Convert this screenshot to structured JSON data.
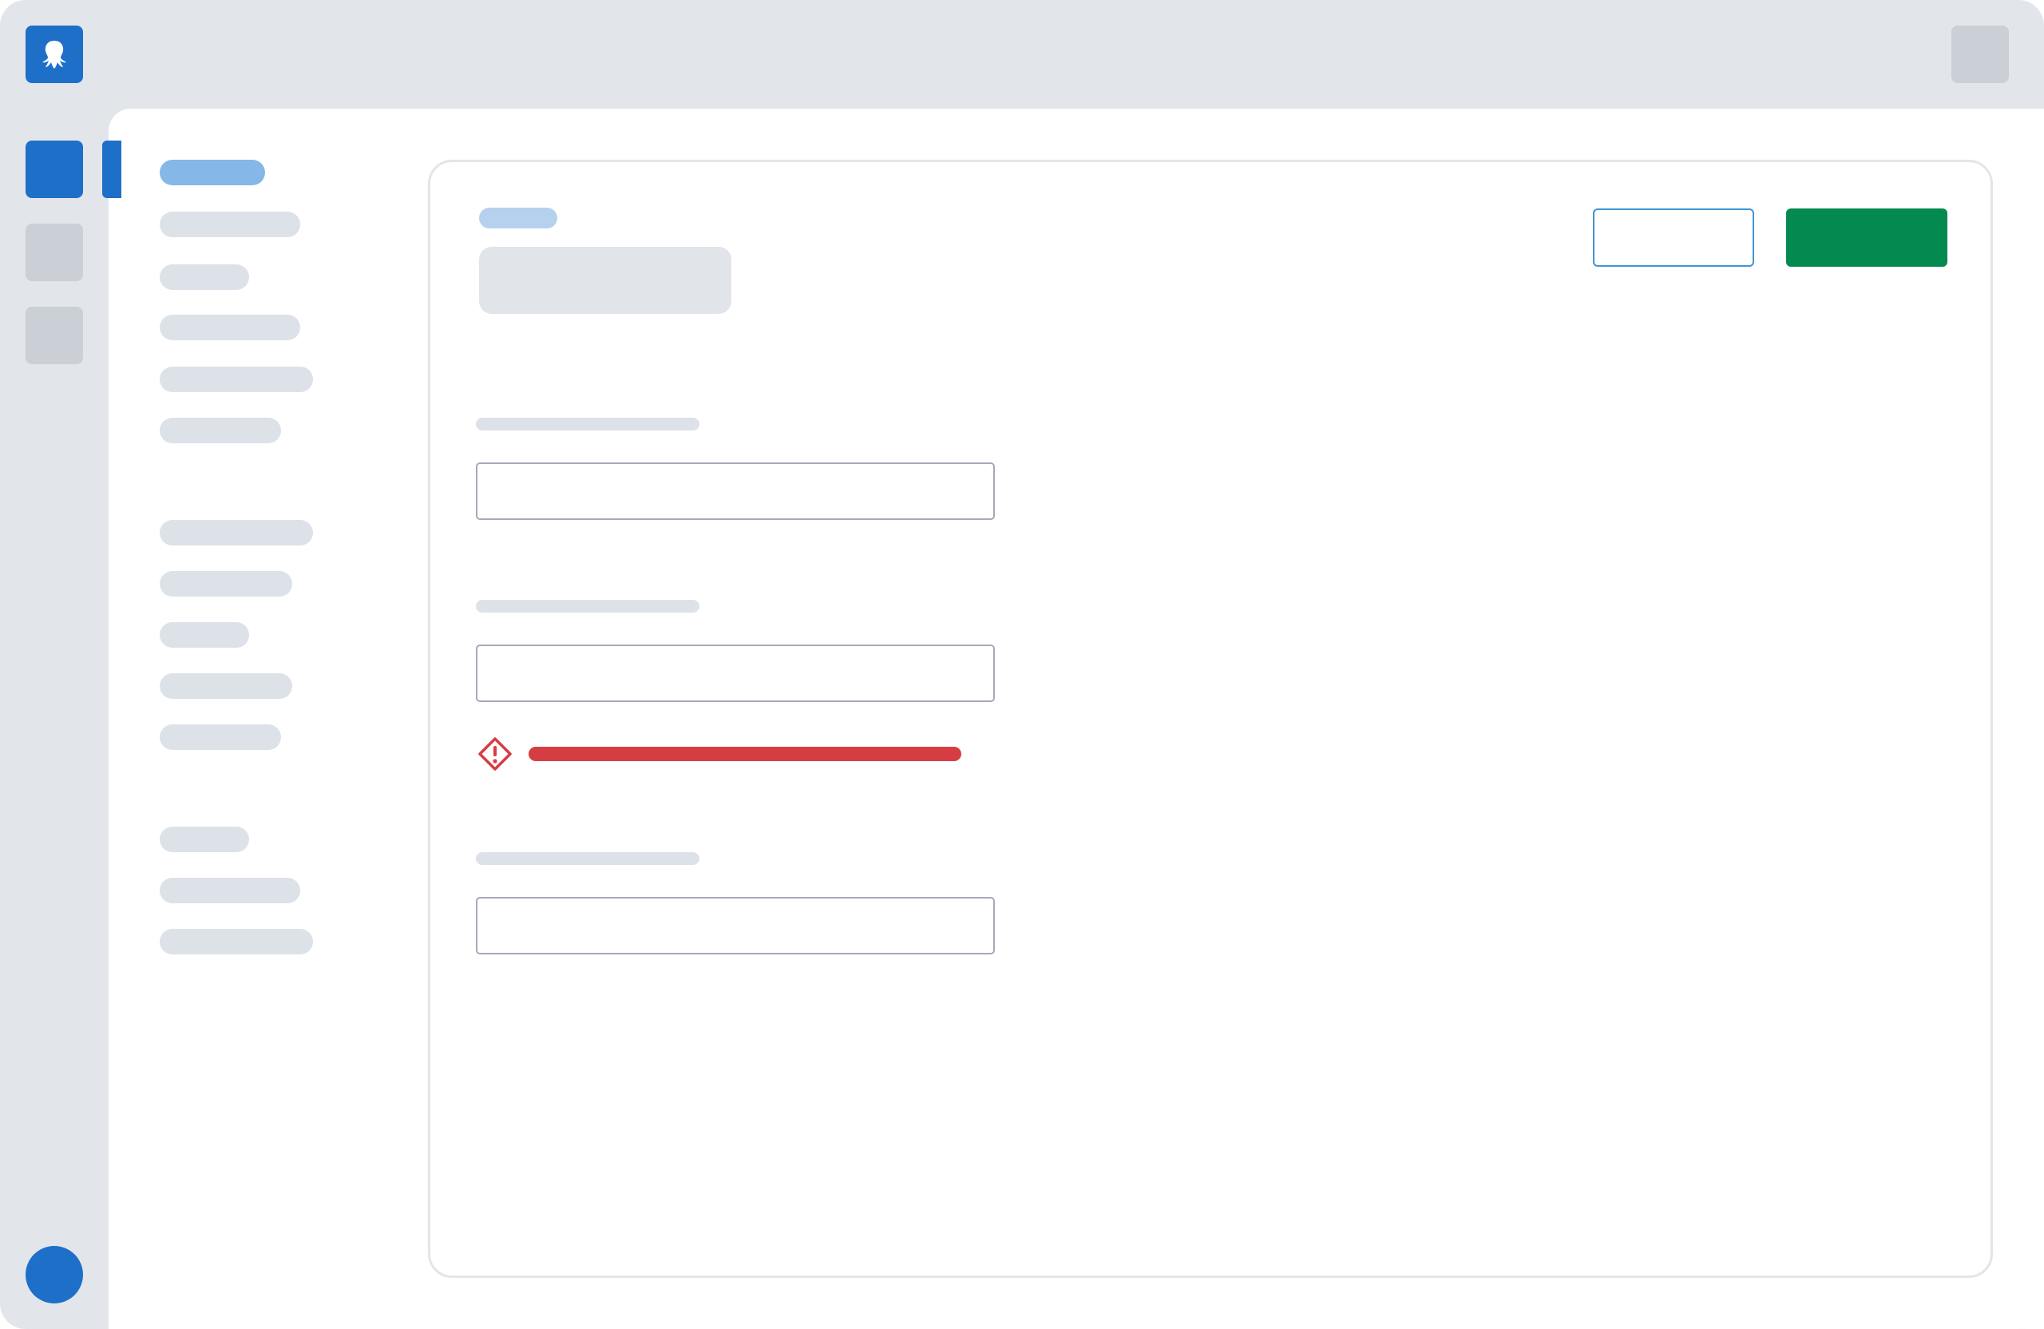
{
  "colors": {
    "frame_bg": "#e2e6eb",
    "brand_blue": "#1e6fc8",
    "rail_inactive": "#cbcfd6",
    "nav_active": "#85b7e8",
    "nav_inactive": "#dce2e8",
    "breadcrumb": "#b5d1ee",
    "title_placeholder": "#e1e4e8",
    "outline_border": "#3c96d6",
    "primary_green": "#048a50",
    "label_placeholder": "#dde2e8",
    "input_border": "#a8a8b8",
    "error_red": "#d63d42"
  },
  "header": {
    "logo_icon": "octopus-logo-icon",
    "menu_icon": "account-menu-icon"
  },
  "rail": {
    "items": [
      {
        "state": "active"
      },
      {
        "state": "inactive"
      },
      {
        "state": "inactive"
      }
    ]
  },
  "sidebar": {
    "groups": [
      {
        "items": [
          {
            "state": "active"
          },
          {
            "state": "inactive"
          },
          {
            "state": "inactive"
          },
          {
            "state": "inactive"
          },
          {
            "state": "inactive"
          },
          {
            "state": "inactive"
          }
        ]
      },
      {
        "items": [
          {
            "state": "inactive"
          },
          {
            "state": "inactive"
          },
          {
            "state": "inactive"
          },
          {
            "state": "inactive"
          },
          {
            "state": "inactive"
          }
        ]
      },
      {
        "items": [
          {
            "state": "inactive"
          },
          {
            "state": "inactive"
          },
          {
            "state": "inactive"
          }
        ]
      }
    ]
  },
  "form": {
    "fields": [
      {
        "state": "default"
      },
      {
        "state": "error"
      },
      {
        "state": "default"
      }
    ],
    "error_icon": "warning-diamond-icon"
  }
}
